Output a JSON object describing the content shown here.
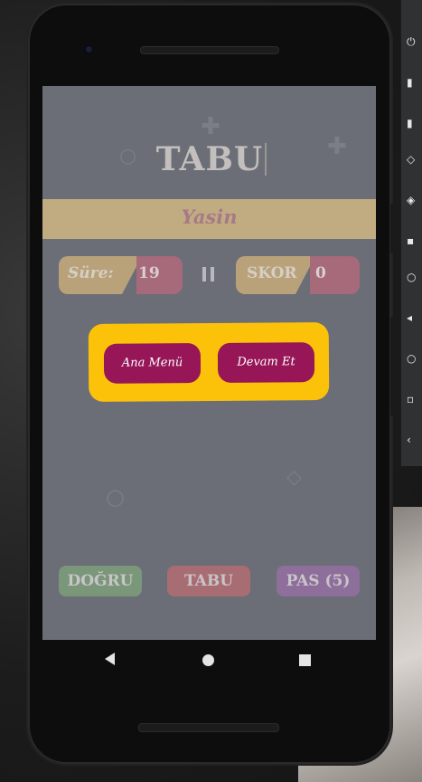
{
  "app": {
    "title": "TABU",
    "player_name": "Yasin"
  },
  "scoreboard": {
    "time_label": "Süre:",
    "time_value": "19",
    "score_label": "SKOR",
    "score_value": "0"
  },
  "pause_dialog": {
    "main_menu_label": "Ana Menü",
    "continue_label": "Devam Et"
  },
  "actions": {
    "correct_label": "DOĞRU",
    "taboo_label": "TABU",
    "pass_label": "PAS (5)"
  },
  "colors": {
    "dialog_background": "#fcc20a",
    "dialog_button": "#961658",
    "overlay": "#6b6e77"
  },
  "icons": [
    "pause-icon",
    "nav-back-icon",
    "nav-home-icon",
    "nav-recents-icon",
    "front-camera-icon"
  ]
}
